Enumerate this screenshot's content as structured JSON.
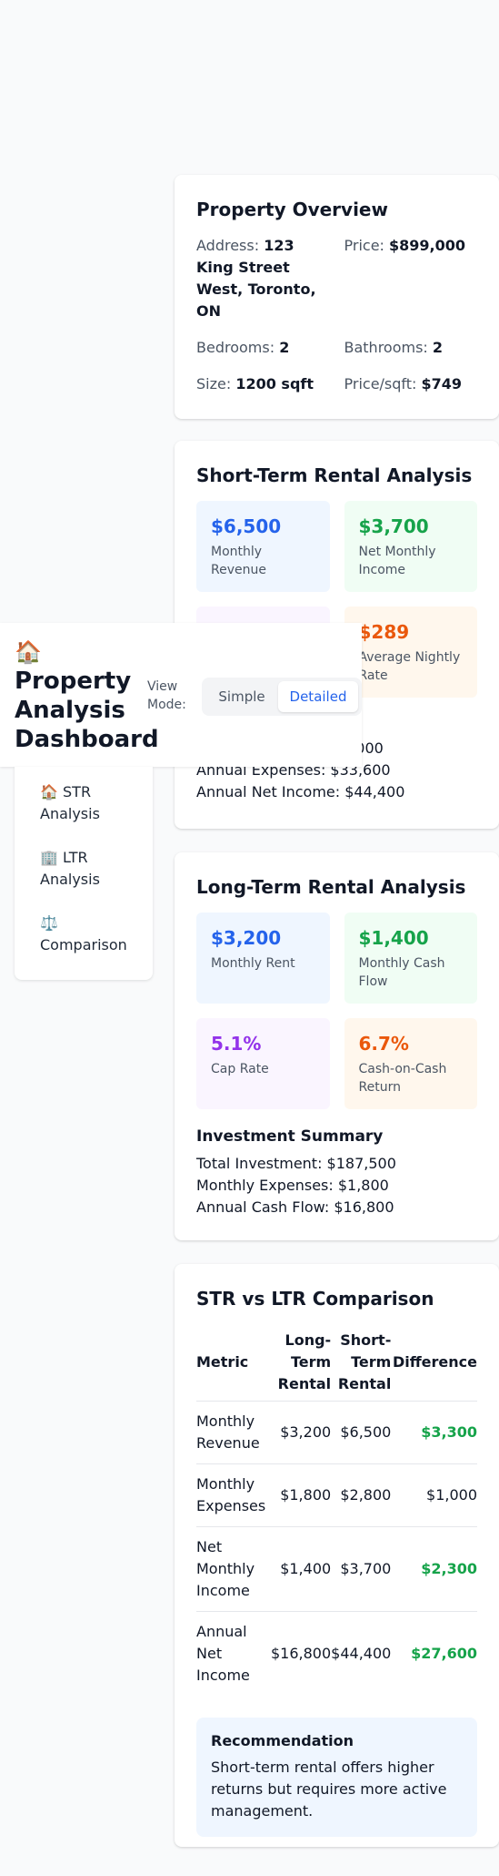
{
  "header": {
    "icon": "house-icon",
    "title": "Property Analysis Dashboard",
    "view_mode_label": "View Mode:",
    "view_options": [
      "Simple",
      "Detailed"
    ],
    "selected_view": "Detailed"
  },
  "sidebar": {
    "items": [
      {
        "icon": "🏠",
        "label": "STR Analysis"
      },
      {
        "icon": "🏢",
        "label": "LTR Analysis"
      },
      {
        "icon": "⚖️",
        "label": "Comparison"
      }
    ]
  },
  "overview": {
    "title": "Property Overview",
    "address_label": "Address:",
    "address_value": "123 King Street West, Toronto, ON",
    "price_label": "Price:",
    "price_value": "$899,000",
    "bedrooms_label": "Bedrooms:",
    "bedrooms_value": "2",
    "bathrooms_label": "Bathrooms:",
    "bathrooms_value": "2",
    "size_label": "Size:",
    "size_value": "1200 sqft",
    "ppsf_label": "Price/sqft:",
    "ppsf_value": "$749"
  },
  "str": {
    "title": "Short-Term Rental Analysis",
    "metrics": [
      {
        "value": "$6,500",
        "label": "Monthly Revenue",
        "color": "#2563eb"
      },
      {
        "value": "$3,700",
        "label": "Net Monthly Income",
        "color": "#16a34a"
      },
      {
        "value": "",
        "label": "",
        "color": "#9333ea"
      },
      {
        "value": "$289",
        "label": "Average Nightly Rate",
        "color": "#ea580c"
      }
    ],
    "partial_line": "8,000",
    "annual_expenses": "Annual Expenses: $33,600",
    "annual_net_income": "Annual Net Income: $44,400"
  },
  "ltr": {
    "title": "Long-Term Rental Analysis",
    "metrics": [
      {
        "value": "$3,200",
        "label": "Monthly Rent",
        "color": "#2563eb"
      },
      {
        "value": "$1,400",
        "label": "Monthly Cash Flow",
        "color": "#16a34a"
      },
      {
        "value": "5.1%",
        "label": "Cap Rate",
        "color": "#9333ea"
      },
      {
        "value": "6.7%",
        "label": "Cash-on-Cash Return",
        "color": "#ea580c"
      }
    ],
    "summary_title": "Investment Summary",
    "total_investment": "Total Investment: $187,500",
    "monthly_expenses": "Monthly Expenses: $1,800",
    "annual_cash_flow": "Annual Cash Flow: $16,800"
  },
  "comparison": {
    "title": "STR vs LTR Comparison",
    "headers": [
      "Metric",
      "Long-Term Rental",
      "Short-Term Rental",
      "Difference"
    ],
    "rows": [
      {
        "metric": "Monthly Revenue",
        "ltr": "$3,200",
        "str": "$6,500",
        "diff": "$3,300",
        "highlight": true
      },
      {
        "metric": "Monthly Expenses",
        "ltr": "$1,800",
        "str": "$2,800",
        "diff": "$1,000",
        "highlight": false
      },
      {
        "metric": "Net Monthly Income",
        "ltr": "$1,400",
        "str": "$3,700",
        "diff": "$2,300",
        "highlight": true
      },
      {
        "metric": "Annual Net Income",
        "ltr": "$16,800",
        "str": "$44,400",
        "diff": "$27,600",
        "highlight": true
      }
    ],
    "recommendation_title": "Recommendation",
    "recommendation_text": "Short-term rental offers higher returns but requires more active management."
  }
}
